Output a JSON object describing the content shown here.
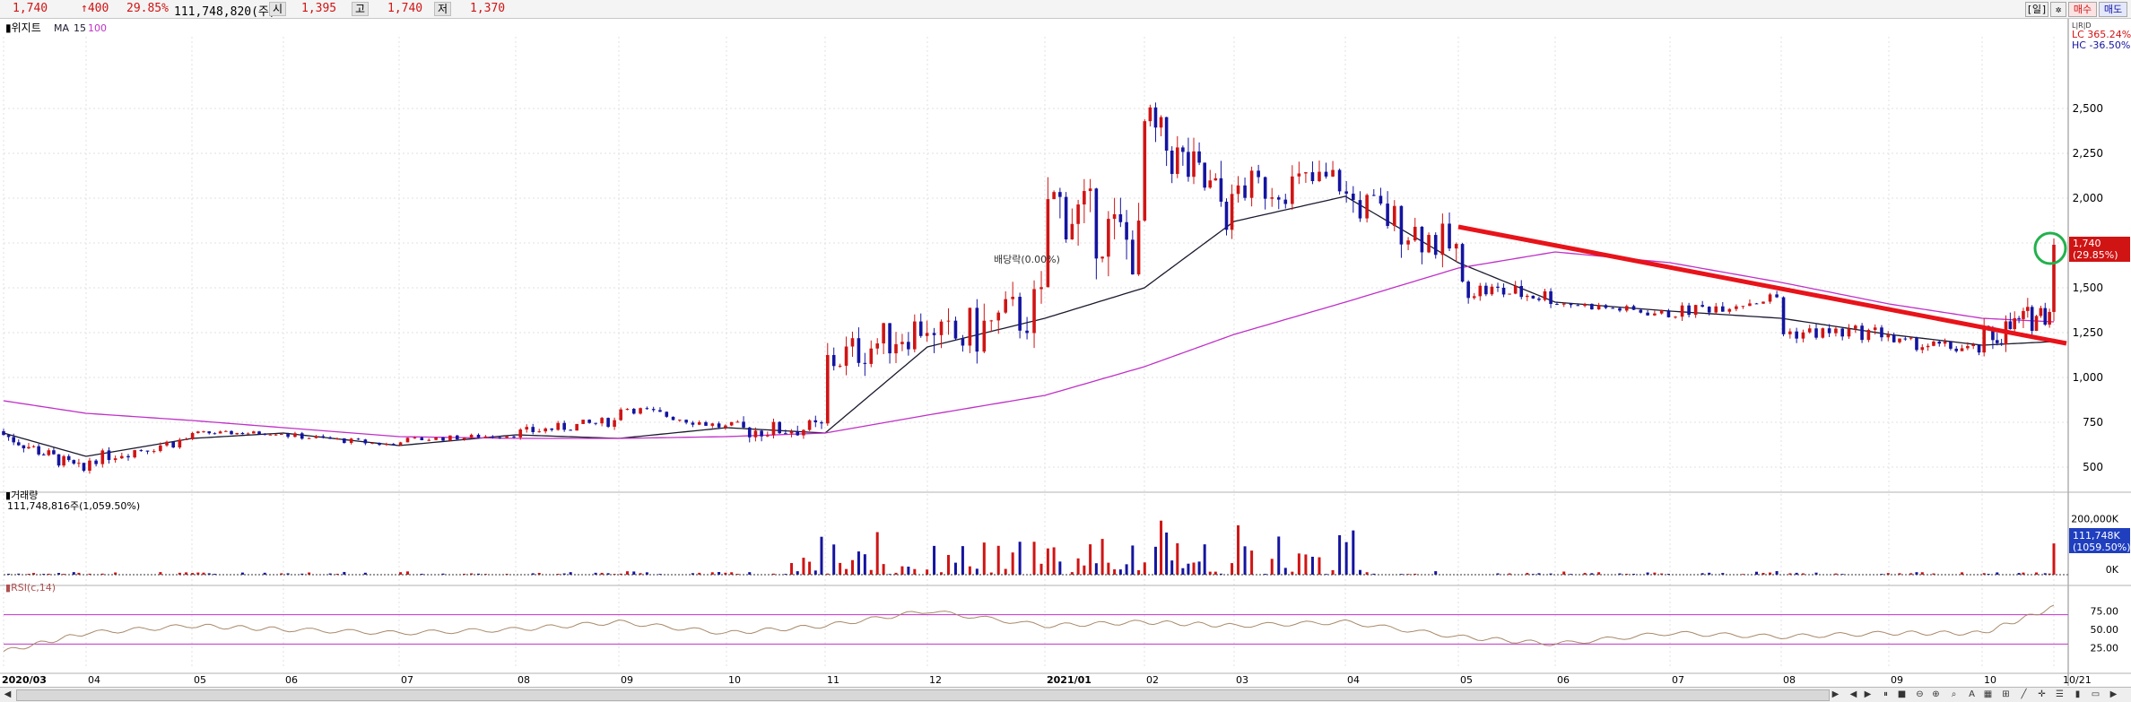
{
  "header": {
    "price": "1,740",
    "change": "↑400",
    "change_pct": "29.85%",
    "volume": "111,748,820(주)",
    "open_label": "시",
    "open": "1,395",
    "high_label": "고",
    "high": "1,740",
    "low_label": "저",
    "low": "1,370",
    "day_button": "[일]",
    "buy_button": "매수",
    "sell_button": "매도"
  },
  "price_panel": {
    "title": "위지트",
    "ma_label": "MA",
    "ma_short": "15",
    "ma_long": "100",
    "lc": "LC 365.24%",
    "hc": "HC -36.50%",
    "lc_hc_tag": "L|R|D",
    "current_price_tag": "1,740",
    "current_pct_tag": "(29.85%)",
    "annotation": "배당락(0.00%)",
    "y_ticks": [
      "2,500",
      "2,250",
      "2,000",
      "1,750",
      "1,500",
      "1,250",
      "1,000",
      "750",
      "500"
    ],
    "accent_red": "#d01414",
    "accent_blue": "#1414a0",
    "ma_short_color": "#1a1a2e",
    "ma_long_color": "#c030c8",
    "trendline_color": "#e8131a",
    "circle_color": "#22b14c"
  },
  "volume_panel": {
    "title": "거래량",
    "value": "111,748,816주(1,059.50%)",
    "y_max_label": "200,000K",
    "y_zero_label": "0K",
    "tag_value": "111,748K",
    "tag_pct": "(1059.50%)"
  },
  "rsi_panel": {
    "title": "RSI(c,14)",
    "y_ticks": [
      "75.00",
      "50.00",
      "25.00"
    ],
    "upper_line": 70,
    "lower_line": 30
  },
  "x_axis": {
    "labels": [
      "2020/03",
      "04",
      "05",
      "06",
      "07",
      "08",
      "09",
      "10",
      "11",
      "12",
      "2021/01",
      "02",
      "03",
      "04",
      "05",
      "06",
      "07",
      "08",
      "09",
      "10",
      "10/21"
    ]
  },
  "chart_data": {
    "type": "candlestick",
    "x_range": [
      "2020/03",
      "10/21"
    ],
    "ylim": [
      400,
      2900
    ],
    "y_scale": "linear",
    "series": [
      {
        "name": "MA 15",
        "x": [
          "2020/03",
          "2020/04",
          "2020/05",
          "2020/06",
          "2020/07",
          "2020/08",
          "2020/09",
          "2020/10",
          "2020/11",
          "2020/12",
          "2021/01",
          "2021/02",
          "2021/03",
          "2021/04",
          "2021/05",
          "2021/06",
          "2021/07",
          "2021/08",
          "2021/09",
          "2021/10",
          "10/21"
        ],
        "values": [
          690,
          560,
          660,
          690,
          620,
          680,
          660,
          720,
          690,
          1170,
          1330,
          1500,
          1870,
          2010,
          1640,
          1420,
          1370,
          1330,
          1240,
          1180,
          1200
        ]
      },
      {
        "name": "MA 100",
        "x": [
          "2020/03",
          "2020/04",
          "2020/05",
          "2020/06",
          "2020/07",
          "2020/08",
          "2020/09",
          "2020/10",
          "2020/11",
          "2020/12",
          "2021/01",
          "2021/02",
          "2021/03",
          "2021/04",
          "2021/05",
          "2021/06",
          "2021/07",
          "2021/08",
          "2021/09",
          "2021/10",
          "10/21"
        ],
        "values": [
          870,
          800,
          760,
          720,
          670,
          660,
          660,
          670,
          690,
          790,
          900,
          1060,
          1240,
          1420,
          1610,
          1700,
          1640,
          1530,
          1410,
          1330,
          1310
        ]
      }
    ],
    "candles_approx": [
      {
        "x": "2020/03",
        "o": 700,
        "h": 720,
        "l": 660,
        "c": 680
      },
      {
        "x": "2020/04",
        "o": 470,
        "h": 560,
        "l": 420,
        "c": 540
      },
      {
        "x": "2020/05",
        "o": 660,
        "h": 700,
        "l": 640,
        "c": 690
      },
      {
        "x": "2020/06",
        "o": 690,
        "h": 730,
        "l": 660,
        "c": 680
      },
      {
        "x": "2020/07",
        "o": 620,
        "h": 660,
        "l": 600,
        "c": 650
      },
      {
        "x": "2020/08",
        "o": 680,
        "h": 720,
        "l": 650,
        "c": 690
      },
      {
        "x": "2020/09",
        "o": 760,
        "h": 880,
        "l": 720,
        "c": 840
      },
      {
        "x": "2020/10",
        "o": 720,
        "h": 760,
        "l": 680,
        "c": 700
      },
      {
        "x": "2020/11",
        "o": 720,
        "h": 1100,
        "l": 700,
        "c": 1080
      },
      {
        "x": "2020/12",
        "o": 1300,
        "h": 1600,
        "l": 1030,
        "c": 1150
      },
      {
        "x": "2021/01",
        "o": 1400,
        "h": 2300,
        "l": 1300,
        "c": 2000
      },
      {
        "x": "2021/02",
        "o": 1700,
        "h": 2850,
        "l": 1600,
        "c": 2400
      },
      {
        "x": "2021/03",
        "o": 1900,
        "h": 2150,
        "l": 1650,
        "c": 2050
      },
      {
        "x": "2021/04",
        "o": 2100,
        "h": 2500,
        "l": 1900,
        "c": 2000
      },
      {
        "x": "2021/05",
        "o": 1700,
        "h": 1800,
        "l": 1550,
        "c": 1500
      },
      {
        "x": "2021/06",
        "o": 1450,
        "h": 1500,
        "l": 1360,
        "c": 1420
      },
      {
        "x": "2021/07",
        "o": 1350,
        "h": 1450,
        "l": 1300,
        "c": 1360
      },
      {
        "x": "2021/08",
        "o": 1450,
        "h": 1500,
        "l": 1200,
        "c": 1250
      },
      {
        "x": "2021/09",
        "o": 1250,
        "h": 1350,
        "l": 1150,
        "c": 1200
      },
      {
        "x": "2021/10",
        "o": 1150,
        "h": 1250,
        "l": 1080,
        "c": 1200
      },
      {
        "x": "10/21",
        "o": 1395,
        "h": 1740,
        "l": 1370,
        "c": 1740
      }
    ],
    "current_price": 1740,
    "yticks": [
      500,
      750,
      1000,
      1250,
      1500,
      1750,
      2000,
      2250,
      2500
    ],
    "trendline": {
      "from": {
        "x": "2021/05",
        "y": 1840
      },
      "to": {
        "x": "10/21",
        "y": 1190
      }
    },
    "volume_ylim": [
      0,
      200000
    ],
    "volume_unit": "K",
    "rsi_ylim": [
      0,
      100
    ],
    "rsi_values_approx": [
      20,
      45,
      55,
      50,
      45,
      50,
      60,
      45,
      55,
      75,
      55,
      60,
      55,
      60,
      40,
      30,
      45,
      40,
      45,
      45,
      80
    ]
  }
}
